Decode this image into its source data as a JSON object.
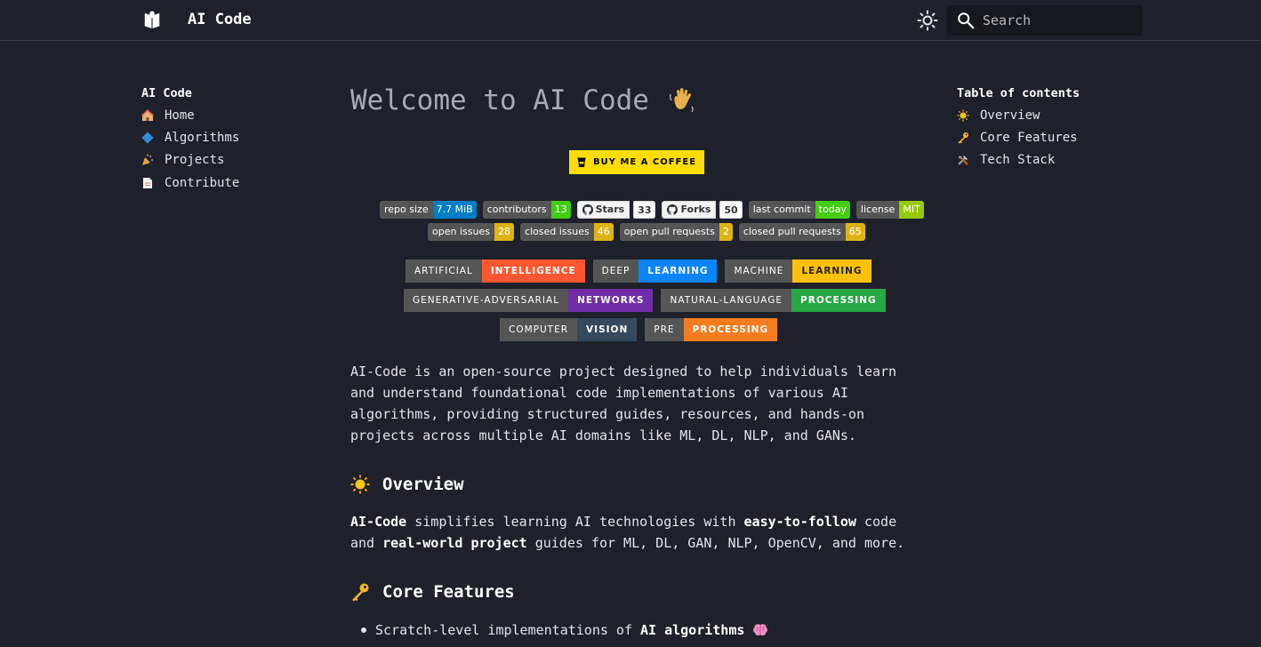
{
  "header": {
    "site_title": "AI Code",
    "search_placeholder": "Search"
  },
  "nav": {
    "title": "AI Code",
    "items": [
      {
        "label": "Home",
        "icon": "house-icon"
      },
      {
        "label": "Algorithms",
        "icon": "blue-diamond-icon"
      },
      {
        "label": "Projects",
        "icon": "party-popper-icon"
      },
      {
        "label": "Contribute",
        "icon": "page-icon"
      }
    ]
  },
  "toc": {
    "title": "Table of contents",
    "items": [
      {
        "label": "Overview",
        "icon": "sun-icon"
      },
      {
        "label": "Core Features",
        "icon": "key-icon"
      },
      {
        "label": "Tech Stack",
        "icon": "tools-icon"
      }
    ]
  },
  "main": {
    "title": "Welcome to AI Code",
    "coffee_label": "BUY ME A COFFEE",
    "badges_row1": [
      {
        "key": "repo size",
        "value": "7.7 MiB",
        "color": "#007ec6"
      },
      {
        "key": "contributors",
        "value": "13",
        "color": "#4c1"
      },
      {
        "key": "Stars",
        "value": "33",
        "social": true
      },
      {
        "key": "Forks",
        "value": "50",
        "social": true
      },
      {
        "key": "last commit",
        "value": "today",
        "color": "#4c1"
      },
      {
        "key": "license",
        "value": "MIT",
        "color": "#97ca00"
      }
    ],
    "badges_row2": [
      {
        "key": "open issues",
        "value": "28",
        "color": "#dfb317"
      },
      {
        "key": "closed issues",
        "value": "46",
        "color": "#dfb317"
      },
      {
        "key": "open pull requests",
        "value": "2",
        "color": "#dfb317"
      },
      {
        "key": "closed pull requests",
        "value": "65",
        "color": "#dfb317"
      }
    ],
    "tags": [
      [
        {
          "key": "ARTIFICIAL",
          "value": "INTELLIGENCE",
          "color": "#ff5733"
        },
        {
          "key": "DEEP",
          "value": "LEARNING",
          "color": "#0a84ff"
        },
        {
          "key": "MACHINE",
          "value": "LEARNING",
          "color": "#ffc107"
        }
      ],
      [
        {
          "key": "GENERATIVE-ADVERSARIAL",
          "value": "NETWORKS",
          "color": "#6f2da8"
        },
        {
          "key": "NATURAL-LANGUAGE",
          "value": "PROCESSING",
          "color": "#28a745"
        }
      ],
      [
        {
          "key": "COMPUTER",
          "value": "VISION",
          "color": "#34495e"
        },
        {
          "key": "PRE",
          "value": "PROCESSING",
          "color": "#f57c1f"
        }
      ]
    ],
    "intro": "AI-Code is an open-source project designed to help individuals learn and understand foundational code implementations of various AI algorithms, providing structured guides, resources, and hands-on projects across multiple AI domains like ML, DL, NLP, and GANs.",
    "overview": {
      "heading": "Overview",
      "b1": "AI-Code",
      "t1": " simplifies learning AI technologies with ",
      "b2": "easy-to-follow",
      "t2": " code and ",
      "b3": "real-world project",
      "t3": " guides for ML, DL, GAN, NLP, OpenCV, and more."
    },
    "core_features": {
      "heading": "Core Features",
      "item1_pre": "Scratch-level implementations of",
      "item1_bold": "AI algorithms"
    }
  }
}
